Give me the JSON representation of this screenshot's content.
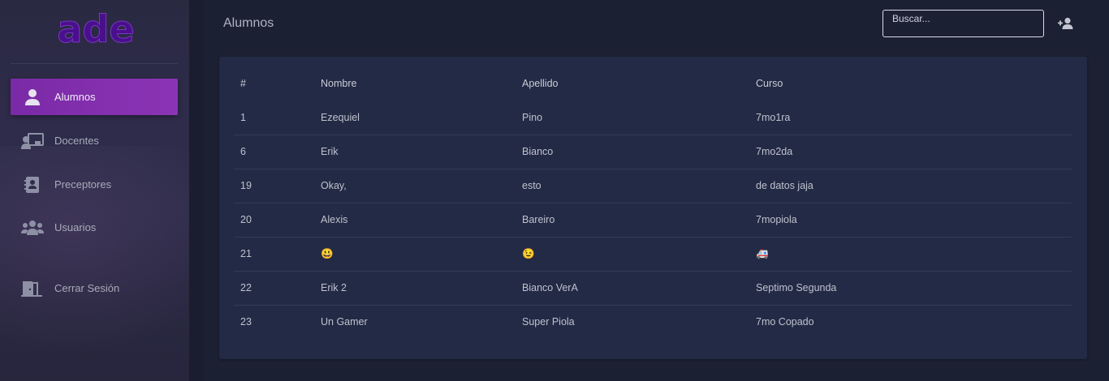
{
  "app": {
    "logo_text": "ade",
    "page_title": "Alumnos"
  },
  "sidebar": {
    "items": [
      {
        "label": "Alumnos",
        "icon": "user-icon",
        "active": true
      },
      {
        "label": "Docentes",
        "icon": "chalkboard-teacher-icon",
        "active": false
      },
      {
        "label": "Preceptores",
        "icon": "address-book-icon",
        "active": false
      },
      {
        "label": "Usuarios",
        "icon": "users-icon",
        "active": false
      },
      {
        "label": "Cerrar Sesión",
        "icon": "door-open-icon",
        "active": false
      }
    ]
  },
  "header": {
    "search_placeholder": "Buscar...",
    "add_icon": "user-plus-icon"
  },
  "table": {
    "headers": [
      "#",
      "Nombre",
      "Apellido",
      "Curso"
    ],
    "rows": [
      [
        "1",
        "Ezequiel",
        "Pino",
        "7mo1ra"
      ],
      [
        "6",
        "Erik",
        "Bianco",
        "7mo2da"
      ],
      [
        "19",
        "Okay,",
        "esto",
        "de datos jaja"
      ],
      [
        "20",
        "Alexis",
        "Bareiro",
        "7mopiola"
      ],
      [
        "21",
        "😃",
        "😉",
        "🚑"
      ],
      [
        "22",
        "Erik 2",
        "Bianco VerA",
        "Septimo Segunda"
      ],
      [
        "23",
        "Un Gamer",
        "Super Piola",
        "7mo Copado"
      ]
    ]
  },
  "colors": {
    "accent": "#8b34b5",
    "logo": "#4a0f8c",
    "background": "#1c2033",
    "card": "#232a45",
    "sidebar": "#2e2c4a"
  }
}
